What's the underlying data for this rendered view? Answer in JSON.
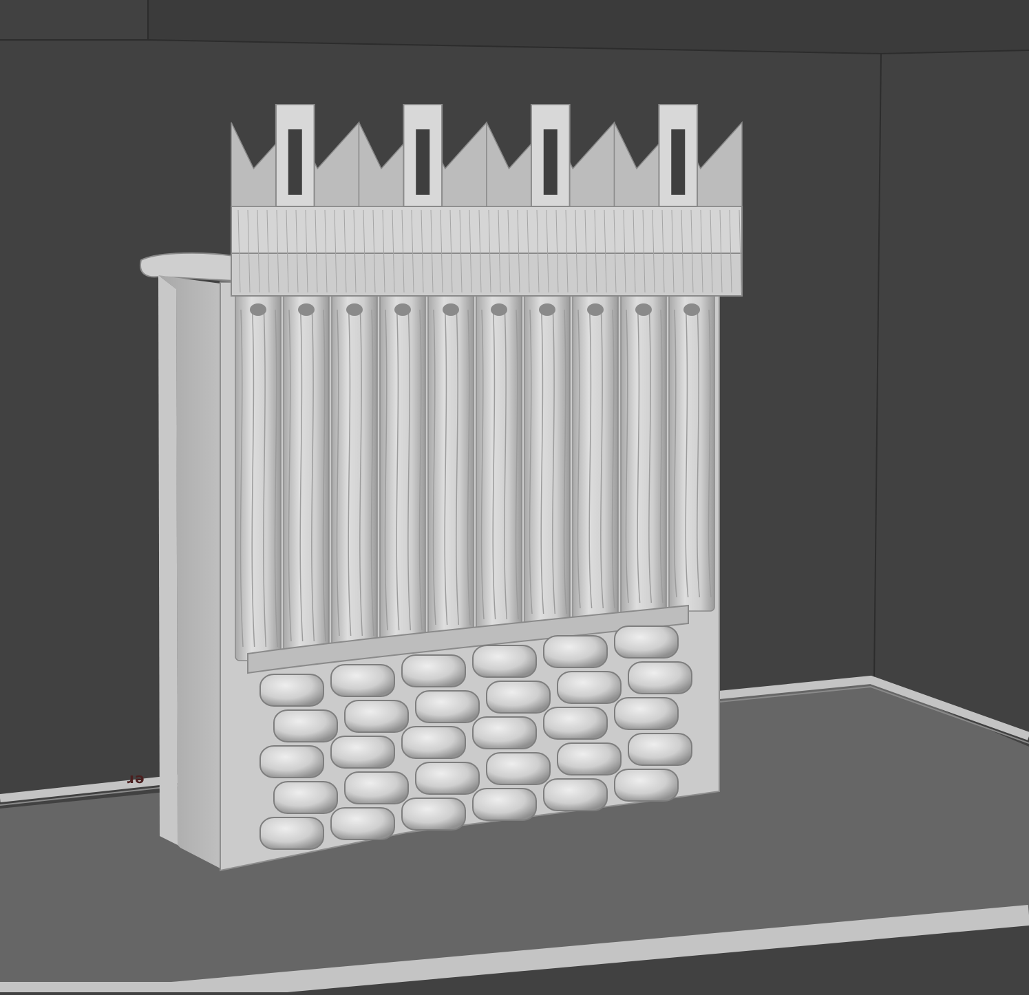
{
  "scene": {
    "bed_label": "er",
    "colors": {
      "background": "#414141",
      "back_panel": "#3a3a3a",
      "frame_line": "#2a2a2a",
      "bed_floor": "#666666",
      "bed_rim": "#bdbdbd",
      "model_light": "#dcdcdc",
      "model_mid": "#c4c4c4",
      "model_dark": "#8c8c8c",
      "model_side": "#b3b3b3"
    },
    "model": {
      "name": "palisade-wall",
      "battlement_window_count": 4,
      "crenellation_spike_count": 8,
      "plank_count": 10,
      "stone_count": 30
    }
  }
}
